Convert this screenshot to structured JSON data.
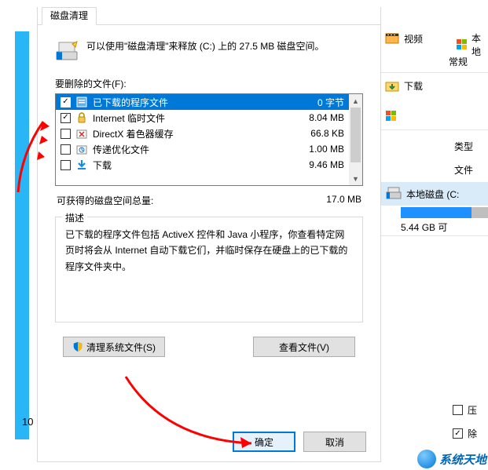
{
  "dialog": {
    "tab": "磁盘清理",
    "intro": "可以使用\"磁盘清理\"来释放  (C:) 上的 27.5 MB 磁盘空间。",
    "list_label": "要删除的文件(F):",
    "items": [
      {
        "checked": true,
        "icon": "program-files",
        "name": "已下载的程序文件",
        "size": "0 字节",
        "selected": true
      },
      {
        "checked": true,
        "icon": "lock",
        "name": "Internet 临时文件",
        "size": "8.04 MB"
      },
      {
        "checked": false,
        "icon": "directx",
        "name": "DirectX 着色器缓存",
        "size": "66.8 KB"
      },
      {
        "checked": false,
        "icon": "delivery",
        "name": "传递优化文件",
        "size": "1.00 MB"
      },
      {
        "checked": false,
        "icon": "download",
        "name": "下载",
        "size": "9.46 MB"
      }
    ],
    "total_label": "可获得的磁盘空间总量:",
    "total_value": "17.0 MB",
    "desc_legend": "描述",
    "desc_text": "已下载的程序文件包括 ActiveX 控件和 Java 小程序，你查看特定网页时将会从 Internet 自动下载它们，并临时保存在硬盘上的已下载的程序文件夹中。",
    "clean_sys": "清理系统文件(S)",
    "view_files": "查看文件(V)",
    "ok": "确定",
    "cancel": "取消"
  },
  "right": {
    "video": "视频",
    "thispc": "本地",
    "nav": "常规",
    "download": "下载",
    "type": "类型",
    "filesys": "文件",
    "drive": "本地磁盘 (C:",
    "free": "5.44 GB 可",
    "chk1": "压",
    "chk2": "除"
  },
  "footer": {
    "ten": "10",
    "brand": "系统天地"
  }
}
